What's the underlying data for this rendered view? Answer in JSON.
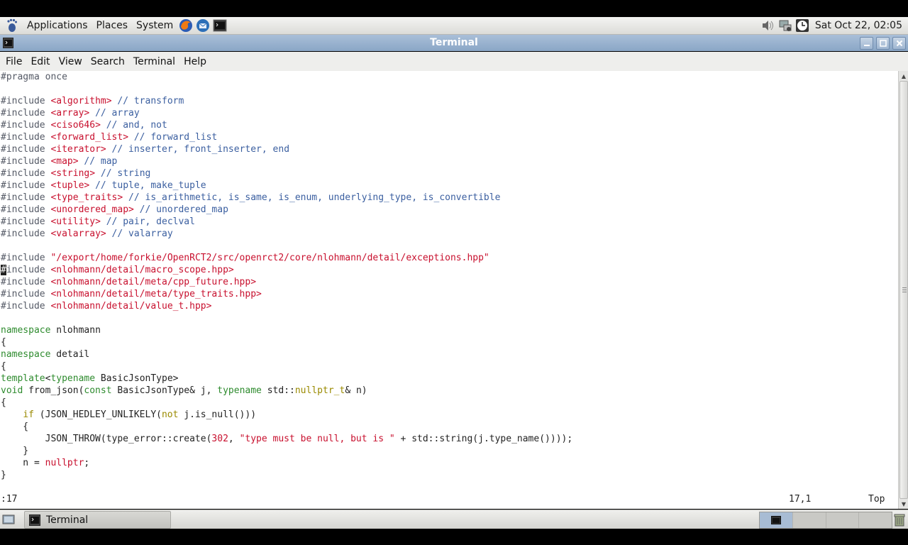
{
  "top_panel": {
    "menus": [
      "Applications",
      "Places",
      "System"
    ],
    "launchers": [
      "firefox-icon",
      "thunderbird-icon",
      "terminal-launcher-icon"
    ],
    "tray": [
      "volume-icon",
      "network-icon",
      "clock-icon"
    ],
    "clock": "Sat Oct 22, 02:05"
  },
  "window": {
    "title": "Terminal",
    "controls": [
      "minimize",
      "maximize",
      "close"
    ]
  },
  "menubar": [
    "File",
    "Edit",
    "View",
    "Search",
    "Terminal",
    "Help"
  ],
  "editor": {
    "lines": [
      [
        [
          "pp",
          "#pragma once"
        ]
      ],
      [],
      [
        [
          "pp",
          "#include "
        ],
        [
          "str",
          "<algorithm>"
        ],
        [
          "com",
          " // transform"
        ]
      ],
      [
        [
          "pp",
          "#include "
        ],
        [
          "str",
          "<array>"
        ],
        [
          "com",
          " // array"
        ]
      ],
      [
        [
          "pp",
          "#include "
        ],
        [
          "str",
          "<ciso646>"
        ],
        [
          "com",
          " // and, not"
        ]
      ],
      [
        [
          "pp",
          "#include "
        ],
        [
          "str",
          "<forward_list>"
        ],
        [
          "com",
          " // forward_list"
        ]
      ],
      [
        [
          "pp",
          "#include "
        ],
        [
          "str",
          "<iterator>"
        ],
        [
          "com",
          " // inserter, front_inserter, end"
        ]
      ],
      [
        [
          "pp",
          "#include "
        ],
        [
          "str",
          "<map>"
        ],
        [
          "com",
          " // map"
        ]
      ],
      [
        [
          "pp",
          "#include "
        ],
        [
          "str",
          "<string>"
        ],
        [
          "com",
          " // string"
        ]
      ],
      [
        [
          "pp",
          "#include "
        ],
        [
          "str",
          "<tuple>"
        ],
        [
          "com",
          " // tuple, make_tuple"
        ]
      ],
      [
        [
          "pp",
          "#include "
        ],
        [
          "str",
          "<type_traits>"
        ],
        [
          "com",
          " // is_arithmetic, is_same, is_enum, underlying_type, is_convertible"
        ]
      ],
      [
        [
          "pp",
          "#include "
        ],
        [
          "str",
          "<unordered_map>"
        ],
        [
          "com",
          " // unordered_map"
        ]
      ],
      [
        [
          "pp",
          "#include "
        ],
        [
          "str",
          "<utility>"
        ],
        [
          "com",
          " // pair, declval"
        ]
      ],
      [
        [
          "pp",
          "#include "
        ],
        [
          "str",
          "<valarray>"
        ],
        [
          "com",
          " // valarray"
        ]
      ],
      [],
      [
        [
          "pp",
          "#include "
        ],
        [
          "str",
          "\"/export/home/forkie/OpenRCT2/src/openrct2/core/nlohmann/detail/exceptions.hpp\""
        ]
      ],
      [
        [
          "cursor",
          "#"
        ],
        [
          "pp",
          "include "
        ],
        [
          "str",
          "<nlohmann/detail/macro_scope.hpp>"
        ]
      ],
      [
        [
          "pp",
          "#include "
        ],
        [
          "str",
          "<nlohmann/detail/meta/cpp_future.hpp>"
        ]
      ],
      [
        [
          "pp",
          "#include "
        ],
        [
          "str",
          "<nlohmann/detail/meta/type_traits.hpp>"
        ]
      ],
      [
        [
          "pp",
          "#include "
        ],
        [
          "str",
          "<nlohmann/detail/value_t.hpp>"
        ]
      ],
      [],
      [
        [
          "kw",
          "namespace"
        ],
        [
          "txt",
          " nlohmann"
        ]
      ],
      [
        [
          "txt",
          "{"
        ]
      ],
      [
        [
          "kw",
          "namespace"
        ],
        [
          "txt",
          " detail"
        ]
      ],
      [
        [
          "txt",
          "{"
        ]
      ],
      [
        [
          "kw",
          "template"
        ],
        [
          "txt",
          "<"
        ],
        [
          "kw",
          "typename"
        ],
        [
          "txt",
          " BasicJsonType>"
        ]
      ],
      [
        [
          "kw",
          "void"
        ],
        [
          "txt",
          " from_json("
        ],
        [
          "kw",
          "const"
        ],
        [
          "txt",
          " BasicJsonType& j, "
        ],
        [
          "kw",
          "typename"
        ],
        [
          "txt",
          " std::"
        ],
        [
          "type",
          "nullptr_t"
        ],
        [
          "txt",
          "& n)"
        ]
      ],
      [
        [
          "txt",
          "{"
        ]
      ],
      [
        [
          "txt",
          "    "
        ],
        [
          "type",
          "if"
        ],
        [
          "txt",
          " (JSON_HEDLEY_UNLIKELY("
        ],
        [
          "type",
          "not"
        ],
        [
          "txt",
          " j.is_null()))"
        ]
      ],
      [
        [
          "txt",
          "    {"
        ]
      ],
      [
        [
          "txt",
          "        JSON_THROW(type_error::create("
        ],
        [
          "str",
          "302"
        ],
        [
          "txt",
          ", "
        ],
        [
          "str",
          "\"type must be null, but is \""
        ],
        [
          "txt",
          " + std::string(j.type_name())));"
        ]
      ],
      [
        [
          "txt",
          "    }"
        ]
      ],
      [
        [
          "txt",
          "    n = "
        ],
        [
          "str",
          "nullptr"
        ],
        [
          "txt",
          ";"
        ]
      ],
      [
        [
          "txt",
          "}"
        ]
      ]
    ],
    "status_command": ":17",
    "status_position": "17,1",
    "status_scroll": "Top"
  },
  "taskbar": {
    "task_label": "Terminal"
  },
  "colors": {
    "preprocessor": "#555a66",
    "string": "#c8102e",
    "comment": "#3b5fa0",
    "keyword": "#2e8b2e",
    "type": "#9a8a00"
  }
}
